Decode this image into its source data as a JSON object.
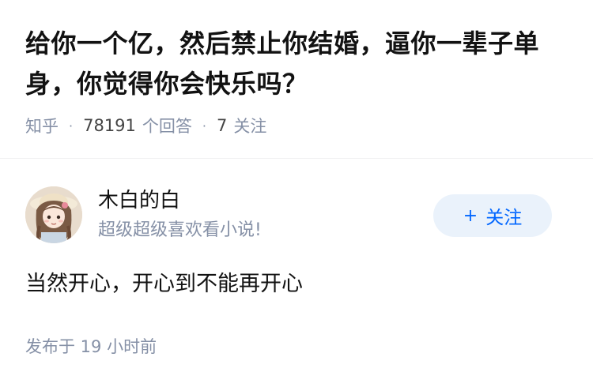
{
  "question": {
    "title": "给你一个亿，然后禁止你结婚，逼你一辈子单身，你觉得你会快乐吗？",
    "source": "知乎",
    "answer_count": "78191",
    "answer_count_label": "个回答",
    "follow_count": "7",
    "follow_label": "关注"
  },
  "answer": {
    "author_name": "木白的白",
    "author_bio": "超级超级喜欢看小说!",
    "follow_button_label": "关注",
    "content": "当然开心，开心到不能再开心",
    "publish_time": "发布于  19 小时前"
  },
  "colors": {
    "accent": "#0066ff",
    "follow_bg": "#eaf2fb",
    "meta_text": "#8590a6",
    "title_text": "#121212"
  },
  "icons": {
    "avatar": "avatar-girl-with-hat",
    "follow_plus": "plus-icon"
  }
}
